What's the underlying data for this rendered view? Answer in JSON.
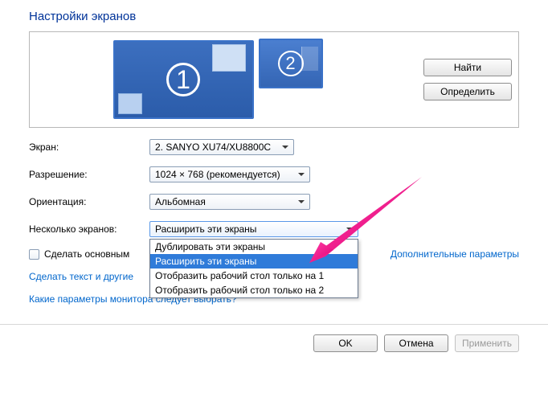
{
  "title": "Настройки экранов",
  "side_buttons": {
    "find": "Найти",
    "detect": "Определить"
  },
  "monitors": {
    "primary": "1",
    "secondary": "2"
  },
  "labels": {
    "display": "Экран:",
    "resolution": "Разрешение:",
    "orientation": "Ориентация:",
    "multi": "Несколько экранов:",
    "make_primary": "Сделать основным",
    "adv_params": "Дополнительные параметры"
  },
  "values": {
    "display": "2. SANYO XU74/XU8800C",
    "resolution": "1024 × 768 (рекомендуется)",
    "orientation": "Альбомная",
    "multi": "Расширить эти экраны"
  },
  "multi_options": [
    "Дублировать эти экраны",
    "Расширить эти экраны",
    "Отобразить рабочий стол только на 1",
    "Отобразить рабочий стол только на 2"
  ],
  "link1": "Сделать текст и другие",
  "link2": "Какие параметры монитора следует выбрать?",
  "footer": {
    "ok": "OK",
    "cancel": "Отмена",
    "apply": "Применить"
  }
}
